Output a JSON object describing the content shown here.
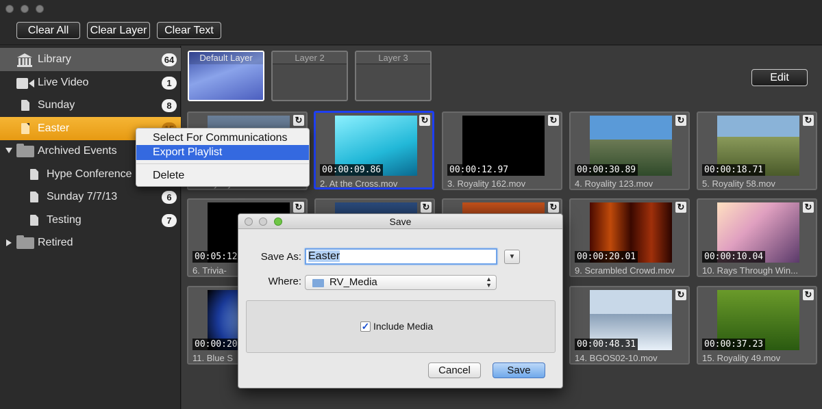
{
  "toolbar": {
    "clear_all": "Clear All",
    "clear_layer": "Clear Layer",
    "clear_text": "Clear Text"
  },
  "sidebar": {
    "items": [
      {
        "label": "Library",
        "count": "64",
        "icon": "library-icon"
      },
      {
        "label": "Live Video",
        "count": "1",
        "icon": "video-camera-icon"
      },
      {
        "label": "Sunday",
        "count": "8",
        "icon": "document-icon"
      },
      {
        "label": "Easter",
        "count": "15",
        "icon": "document-icon"
      },
      {
        "label": "Archived Events",
        "count": "",
        "icon": "folder-icon"
      },
      {
        "label": "Hype Conference",
        "count": "",
        "icon": "document-icon"
      },
      {
        "label": "Sunday 7/7/13",
        "count": "6",
        "icon": "document-icon"
      },
      {
        "label": "Testing",
        "count": "7",
        "icon": "document-icon"
      },
      {
        "label": "Retired",
        "count": "",
        "icon": "folder-icon"
      }
    ]
  },
  "layers": [
    {
      "label": "Default Layer",
      "active": true
    },
    {
      "label": "Layer 2",
      "active": false
    },
    {
      "label": "Layer 3",
      "active": false
    }
  ],
  "edit_label": "Edit",
  "media": [
    {
      "time": "",
      "name": "1. Royalty 170.mov"
    },
    {
      "time": "00:00:09.86",
      "name": "2. At the Cross.mov"
    },
    {
      "time": "00:00:12.97",
      "name": "3. Royality 162.mov"
    },
    {
      "time": "00:00:30.89",
      "name": "4. Royality 123.mov"
    },
    {
      "time": "00:00:18.71",
      "name": "5. Royality 58.mov"
    },
    {
      "time": "00:05:12",
      "name": "6. Trivia-"
    },
    {
      "time": "",
      "name": ""
    },
    {
      "time": "",
      "name": ""
    },
    {
      "time": "00:00:20.01",
      "name": "9. Scrambled Crowd.mov"
    },
    {
      "time": "00:00:10.04",
      "name": "10. Rays Through Win..."
    },
    {
      "time": "00:00:20",
      "name": "11. Blue S"
    },
    {
      "time": "",
      "name": ""
    },
    {
      "time": "",
      "name": ""
    },
    {
      "time": "00:00:48.31",
      "name": "14. BGOS02-10.mov"
    },
    {
      "time": "00:00:37.23",
      "name": "15. Royality 49.mov"
    }
  ],
  "context_menu": {
    "items": [
      "Select For Communications",
      "Export Playlist",
      "Delete"
    ]
  },
  "dialog": {
    "title": "Save",
    "save_as_label": "Save As:",
    "save_as_value": "Easter",
    "where_label": "Where:",
    "where_value": "RV_Media",
    "include_media": "Include Media",
    "cancel": "Cancel",
    "save": "Save"
  },
  "colors": {
    "selected_sidebar": "#f0a820",
    "selection_blue": "#1e3ff2",
    "menu_highlight": "#3469e0"
  }
}
